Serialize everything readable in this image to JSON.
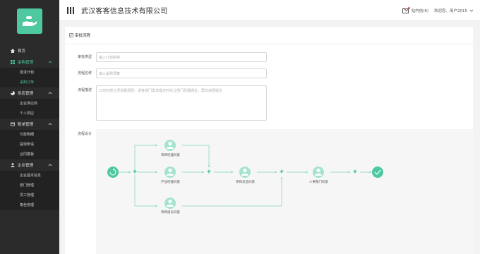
{
  "header": {
    "company": "武汉客客信息技术有限公司",
    "messages": "站内信(6)",
    "welcome": "欢迎您、用户2015"
  },
  "sidebar": {
    "groups": [
      {
        "label": "首页",
        "items": []
      },
      {
        "label": "采购管理",
        "items": [
          "需求计划",
          "采购订单"
        ]
      },
      {
        "label": "供应管理",
        "items": [
          "企业供应商",
          "个人供应"
        ]
      },
      {
        "label": "账单管理",
        "items": [
          "付款明细",
          "提现申请",
          "合同模板"
        ]
      },
      {
        "label": "企业管理",
        "items": [
          "企业基本信息",
          "部门管理",
          "员工管理",
          "角色管理"
        ]
      }
    ]
  },
  "card": {
    "title": "审批流程",
    "fields": {
      "type_label": "审批类型",
      "type_placeholder": "输入计划名称",
      "name_label": "流程名称",
      "name_placeholder": "输入采购预算",
      "desc_label": "流程描述",
      "desc_placeholder": "公司内部立项流程规则，请各部门需求提交时先让部门经理通过，再向高层提交",
      "design_label": "流程设计"
    },
    "flow": {
      "nodes": [
        "项目经理同意",
        "产品经理同意",
        "项目组长同意",
        "项目总监同意",
        "人事部门同意"
      ]
    }
  },
  "colors": {
    "accent": "#4dc8a0",
    "sidebar": "#2b2b2b"
  }
}
